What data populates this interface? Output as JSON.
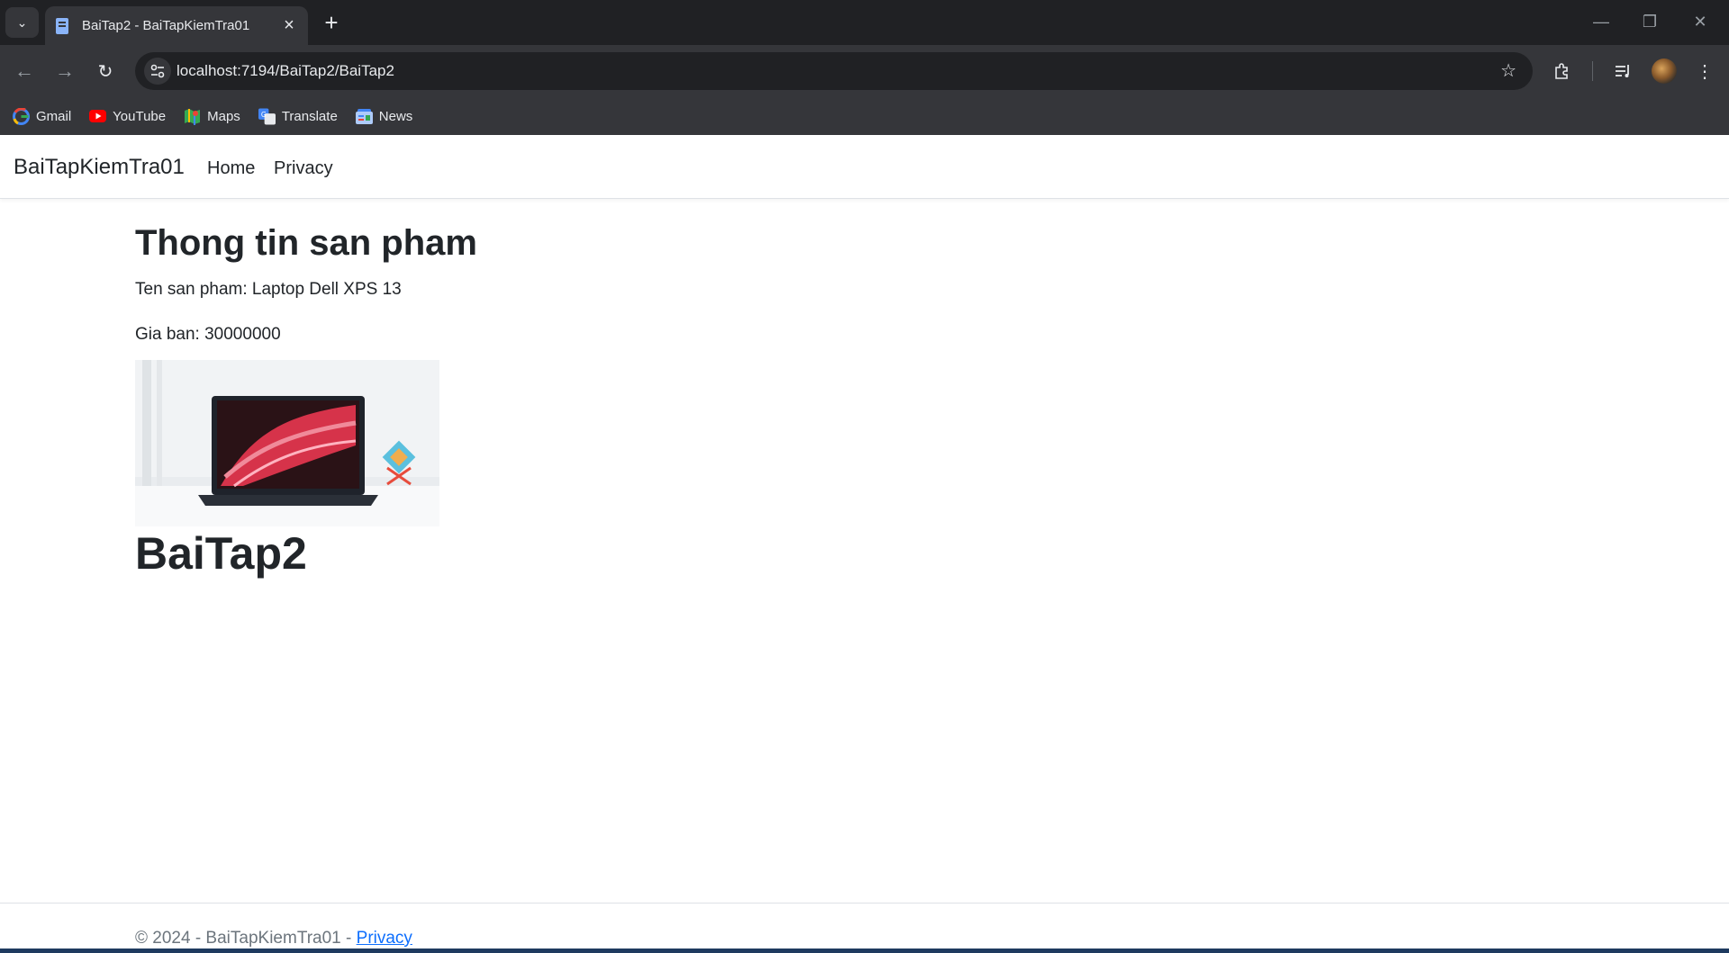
{
  "browser": {
    "tab_title": "BaiTap2 - BaiTapKiemTra01",
    "url": "localhost:7194/BaiTap2/BaiTap2",
    "bookmarks": [
      {
        "label": "Gmail",
        "icon": "gmail-icon"
      },
      {
        "label": "YouTube",
        "icon": "youtube-icon"
      },
      {
        "label": "Maps",
        "icon": "maps-icon"
      },
      {
        "label": "Translate",
        "icon": "translate-icon"
      },
      {
        "label": "News",
        "icon": "news-icon"
      }
    ],
    "colors": {
      "frame": "#202124",
      "toolbar": "#35363a",
      "text": "#e8eaed"
    }
  },
  "navbar": {
    "brand": "BaiTapKiemTra01",
    "links": [
      "Home",
      "Privacy"
    ]
  },
  "main": {
    "heading": "Thong tin san pham",
    "product_name_line": "Ten san pham: Laptop Dell XPS 13",
    "price_line": "Gia ban: 30000000",
    "page_title": "BaiTap2"
  },
  "footer": {
    "text": "© 2024 - BaiTapKiemTra01 - ",
    "link": "Privacy"
  }
}
